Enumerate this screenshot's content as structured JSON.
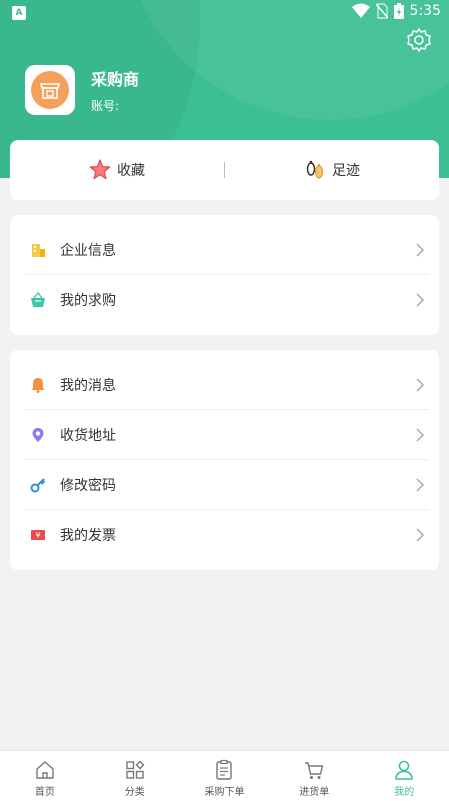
{
  "status_bar": {
    "time": "5:35"
  },
  "profile": {
    "name": "采购商",
    "account_label": "账号:"
  },
  "quick_links": [
    {
      "label": "收藏",
      "icon": "star-icon"
    },
    {
      "label": "足迹",
      "icon": "footprint-icon"
    }
  ],
  "menu_group_1": [
    {
      "label": "企业信息",
      "icon": "building-icon"
    },
    {
      "label": "我的求购",
      "icon": "basket-icon"
    }
  ],
  "menu_group_2": [
    {
      "label": "我的消息",
      "icon": "bell-icon"
    },
    {
      "label": "收货地址",
      "icon": "location-pin-icon"
    },
    {
      "label": "修改密码",
      "icon": "key-icon"
    },
    {
      "label": "我的发票",
      "icon": "invoice-icon"
    }
  ],
  "tabbar": [
    {
      "label": "首页",
      "icon": "home-icon"
    },
    {
      "label": "分类",
      "icon": "category-icon"
    },
    {
      "label": "采购下单",
      "icon": "clipboard-icon"
    },
    {
      "label": "进货单",
      "icon": "cart-icon"
    },
    {
      "label": "我的",
      "icon": "user-icon",
      "active": true
    }
  ],
  "colors": {
    "accent": "#3cbf94",
    "background": "#f2f2f2"
  }
}
